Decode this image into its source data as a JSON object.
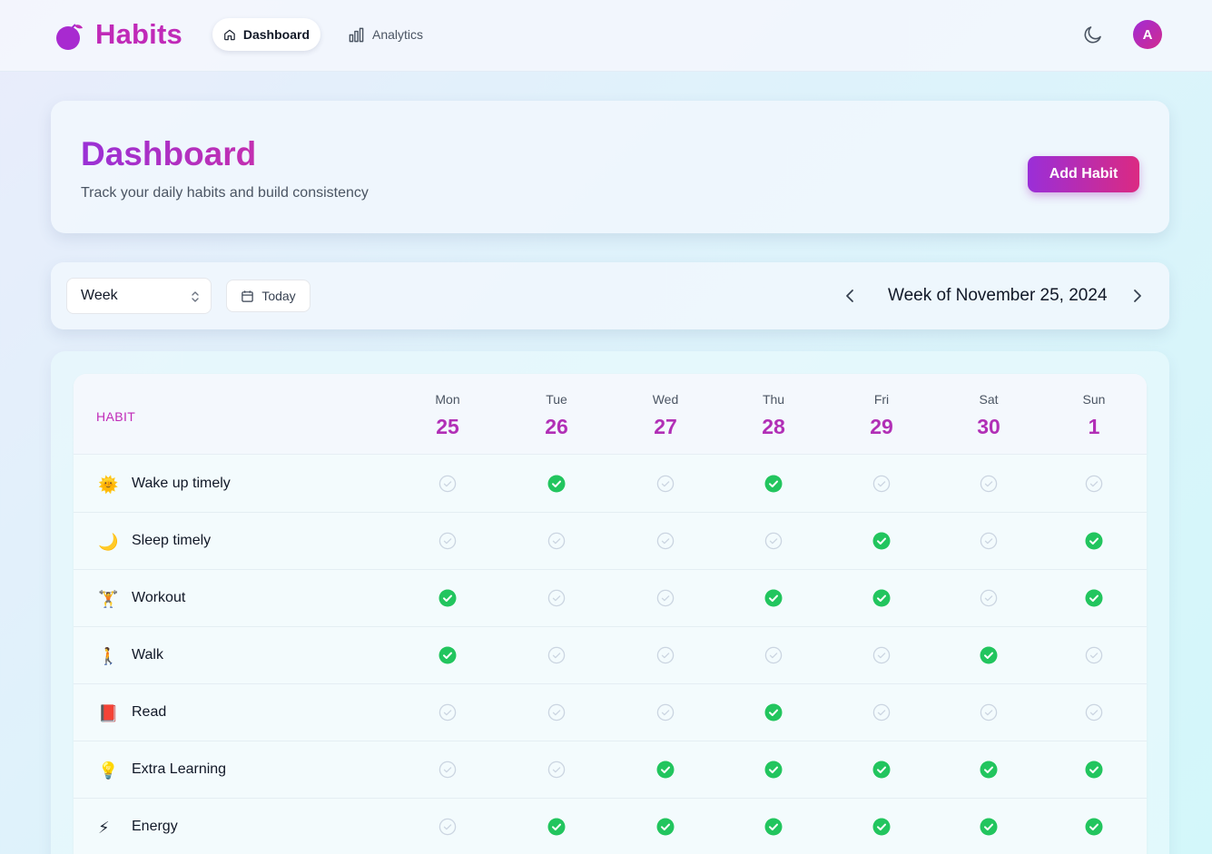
{
  "nav": {
    "brand": "Habits",
    "tabs": [
      {
        "label": "Dashboard",
        "icon": "home-icon",
        "active": true
      },
      {
        "label": "Analytics",
        "icon": "bar-chart-icon",
        "active": false
      }
    ],
    "avatar_initial": "A"
  },
  "header": {
    "title": "Dashboard",
    "subtitle": "Track your daily habits and build consistency",
    "add_button": "Add Habit"
  },
  "controls": {
    "view_select": "Week",
    "today_button": "Today",
    "week_label": "Week of November 25, 2024"
  },
  "table": {
    "habit_header": "HABIT",
    "days": [
      {
        "name": "Mon",
        "date": "25"
      },
      {
        "name": "Tue",
        "date": "26"
      },
      {
        "name": "Wed",
        "date": "27"
      },
      {
        "name": "Thu",
        "date": "28"
      },
      {
        "name": "Fri",
        "date": "29"
      },
      {
        "name": "Sat",
        "date": "30"
      },
      {
        "name": "Sun",
        "date": "1"
      }
    ],
    "habits": [
      {
        "name": "Wake up timely",
        "icon": "sun-icon",
        "emoji": "🌞",
        "done": [
          false,
          true,
          false,
          true,
          false,
          false,
          false
        ]
      },
      {
        "name": "Sleep timely",
        "icon": "moon-icon",
        "emoji": "🌙",
        "done": [
          false,
          false,
          false,
          false,
          true,
          false,
          true
        ]
      },
      {
        "name": "Workout",
        "icon": "weightlifter-icon",
        "emoji": "🏋",
        "done": [
          true,
          false,
          false,
          true,
          true,
          false,
          true
        ]
      },
      {
        "name": "Walk",
        "icon": "walking-icon",
        "emoji": "🚶",
        "done": [
          true,
          false,
          false,
          false,
          false,
          true,
          false
        ]
      },
      {
        "name": "Read",
        "icon": "book-icon",
        "emoji": "📕",
        "done": [
          false,
          false,
          false,
          true,
          false,
          false,
          false
        ]
      },
      {
        "name": "Extra Learning",
        "icon": "lightbulb-icon",
        "emoji": "💡",
        "done": [
          false,
          false,
          true,
          true,
          true,
          true,
          true
        ]
      },
      {
        "name": "Energy",
        "icon": "lightning-icon",
        "emoji": "⚡",
        "done": [
          false,
          true,
          true,
          true,
          true,
          true,
          true
        ]
      }
    ]
  },
  "colors": {
    "brand": "#c02ab8",
    "accent_gradient_start": "#9a2ed8",
    "accent_gradient_end": "#db2a82",
    "check_done": "#22c55e",
    "check_empty": "#cbd5e1"
  }
}
